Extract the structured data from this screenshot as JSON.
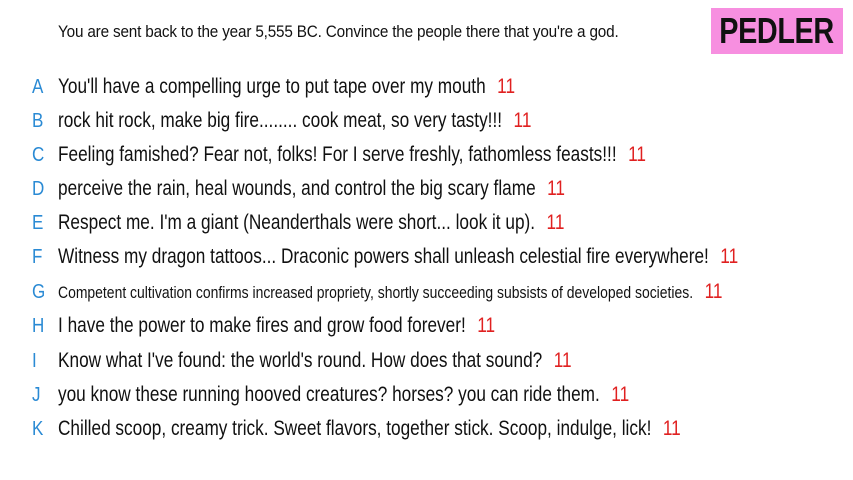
{
  "prompt": "You are sent back to the year 5,555 BC. Convince the people there that you're a god.",
  "player_name": "PEDLER",
  "answers": [
    {
      "letter": "A",
      "text": "You'll have a compelling urge to put tape over my mouth",
      "score": "11"
    },
    {
      "letter": "B",
      "text": "rock hit rock, make big fire........ cook meat, so very tasty!!!",
      "score": "11"
    },
    {
      "letter": "C",
      "text": "Feeling famished? Fear not, folks! For I serve freshly, fathomless feasts!!!",
      "score": "11"
    },
    {
      "letter": "D",
      "text": "perceive the rain, heal wounds, and control the big scary flame",
      "score": "11"
    },
    {
      "letter": "E",
      "text": "Respect me. I'm a giant (Neanderthals were short... look it up).",
      "score": "11"
    },
    {
      "letter": "F",
      "text": "Witness my dragon tattoos... Draconic powers shall unleash celestial fire everywhere!",
      "score": "11"
    },
    {
      "letter": "G",
      "text": "Competent cultivation confirms increased propriety, shortly succeeding subsists of developed societies.",
      "score": "11"
    },
    {
      "letter": "H",
      "text": "I have the power to make fires and grow food forever!",
      "score": "11"
    },
    {
      "letter": "I",
      "text": "Know what I've found: the world's round. How does that sound?",
      "score": "11"
    },
    {
      "letter": "J",
      "text": "you know these running hooved creatures? horses? you can ride them.",
      "score": "11"
    },
    {
      "letter": "K",
      "text": "Chilled scoop, creamy trick. Sweet flavors, together stick. Scoop, indulge, lick!",
      "score": "11"
    }
  ],
  "colors": {
    "letter": "#2a8ad4",
    "score": "#e02020",
    "badge_bg": "#f78fe0"
  }
}
